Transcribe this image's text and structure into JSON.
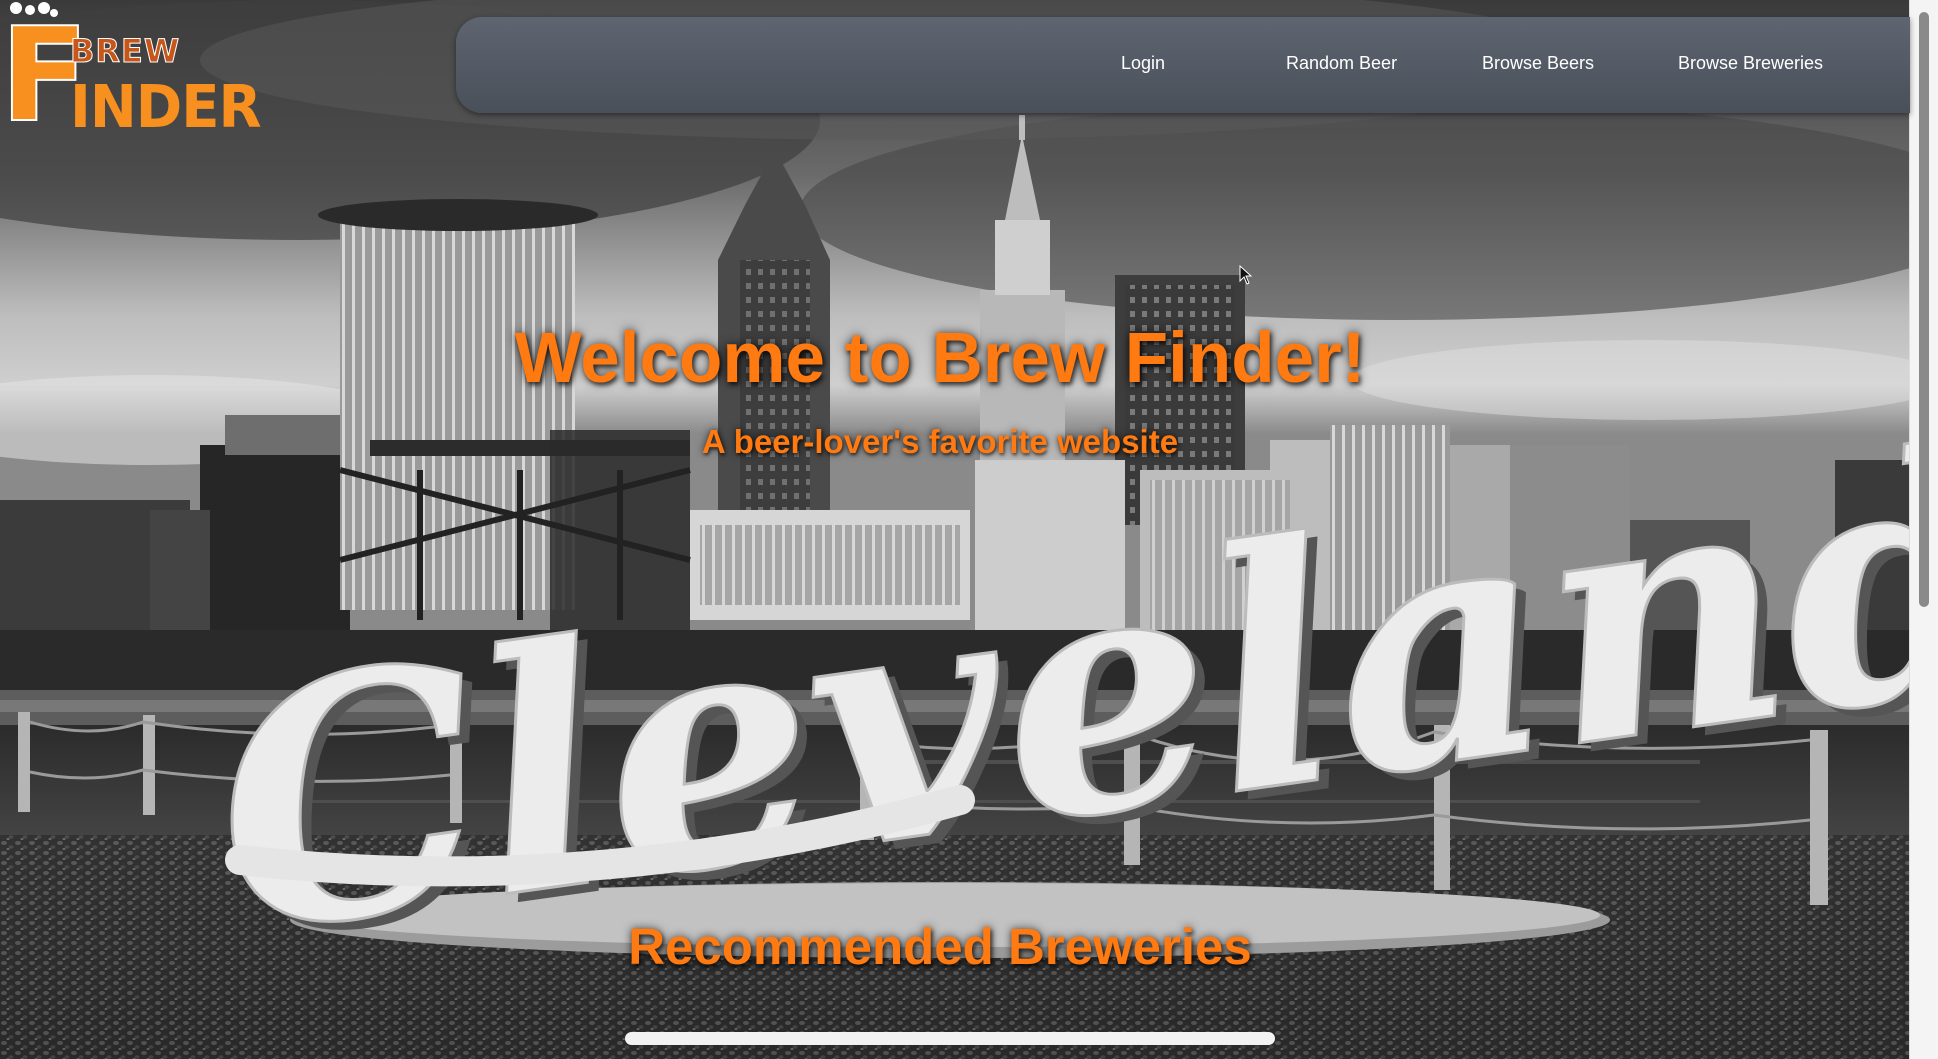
{
  "brand": {
    "logo_letter": "F",
    "logo_word_top": "BREW",
    "logo_word_bottom": "INDER"
  },
  "nav": {
    "items": [
      {
        "label": "Login"
      },
      {
        "label": "Random Beer"
      },
      {
        "label": "Browse Beers"
      },
      {
        "label": "Browse Breweries"
      }
    ]
  },
  "hero": {
    "title": "Welcome to Brew Finder!",
    "subtitle": "A beer-lover's favorite website",
    "sign_text": "Cleveland"
  },
  "sections": {
    "recommended_heading": "Recommended Breweries"
  },
  "colors": {
    "accent": "#ff7a10",
    "navbar": "#50565f",
    "logo_orange": "#f7901e",
    "logo_dark_orange": "#c6561a"
  }
}
